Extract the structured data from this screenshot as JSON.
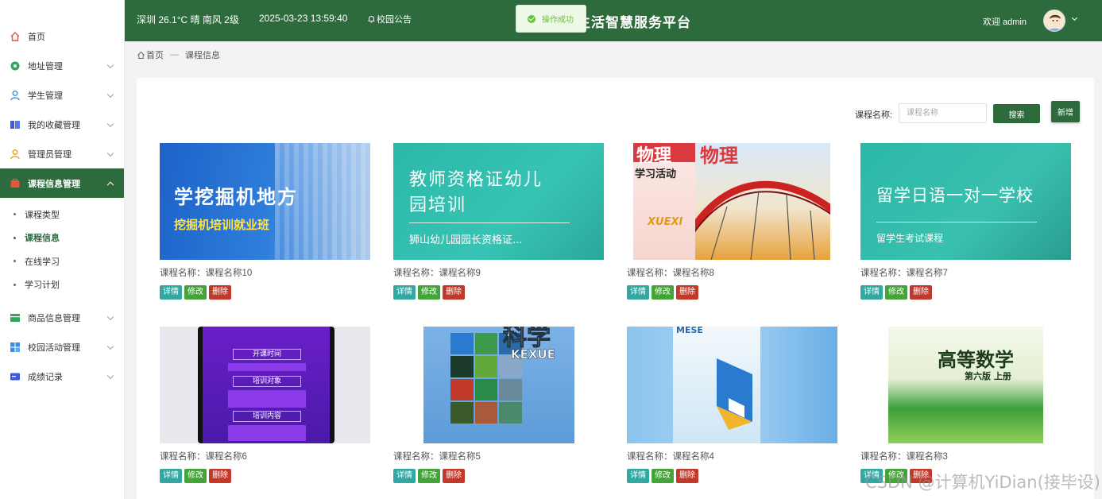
{
  "sidebar": {
    "items": [
      {
        "label": "首页",
        "icon": "home-icon",
        "color": "#e2563c",
        "has_children": false
      },
      {
        "label": "地址管理",
        "icon": "location-icon",
        "color": "#2fa85a",
        "has_children": true
      },
      {
        "label": "学生管理",
        "icon": "user-icon",
        "color": "#3c8fe0",
        "has_children": true
      },
      {
        "label": "我的收藏管理",
        "icon": "collection-icon",
        "color": "#3c5be0",
        "has_children": true
      },
      {
        "label": "管理员管理",
        "icon": "admin-icon",
        "color": "#e6a21a",
        "has_children": true
      },
      {
        "label": "课程信息管理",
        "icon": "course-icon",
        "color": "#e2563c",
        "has_children": true,
        "active": true
      },
      {
        "label": "商品信息管理",
        "icon": "goods-icon",
        "color": "#2fa85a",
        "has_children": true
      },
      {
        "label": "校园活动管理",
        "icon": "activity-icon",
        "color": "#3c8fe0",
        "has_children": true
      },
      {
        "label": "成绩记录",
        "icon": "record-icon",
        "color": "#3c5be0",
        "has_children": true
      }
    ],
    "submenu": [
      "课程类型",
      "课程信息",
      "在线学习",
      "学习计划"
    ],
    "submenu_active": 1
  },
  "header": {
    "weather": "深圳 26.1°C 晴 南风 2级",
    "datetime": "2025-03-23 13:59:40",
    "notice": "校园公告",
    "title": "生活智慧服务平台",
    "welcome": "欢迎 admin",
    "toast": "操作成功"
  },
  "breadcrumb": {
    "home": "首页",
    "sep": "—",
    "current": "课程信息"
  },
  "search": {
    "label": "课程名称:",
    "placeholder": "课程名称",
    "button": "搜索",
    "add_button": "新增"
  },
  "labels": {
    "detail": "详情",
    "edit": "修改",
    "delete": "删除"
  },
  "cards": [
    {
      "title": "课程名称：课程名称10",
      "img_line1": "学挖掘机地方",
      "img_line2": "挖掘机培训就业班"
    },
    {
      "title": "课程名称：课程名称9",
      "img_line1": "教师资格证幼儿",
      "img_line1b": "园培训",
      "img_line2": "狮山幼儿园园长资格证..."
    },
    {
      "title": "课程名称：课程名称8",
      "img_line1": "物理",
      "img_line2": "学习活动",
      "img_line3": "XUEXI"
    },
    {
      "title": "课程名称：课程名称7",
      "img_line1": "留学日语一对一学校",
      "img_line2": "留学生考试课程"
    },
    {
      "title": "课程名称：课程名称6",
      "img_line1": "开课时间",
      "img_line2": "培训对象",
      "img_line3": "培训内容"
    },
    {
      "title": "课程名称：课程名称5",
      "img_line1": "科学",
      "img_line2": "KEXUE"
    },
    {
      "title": "课程名称：课程名称4",
      "img_line1": "MESE"
    },
    {
      "title": "课程名称：课程名称3",
      "img_line1": "高等数学",
      "img_line2": "第六版 上册"
    }
  ],
  "watermark": "CSDN @计算机YiDian(接毕设)",
  "colors": {
    "primary": "#2d6b3c",
    "detail": "#35a7a3",
    "edit": "#45a33a",
    "delete": "#c0392b"
  }
}
